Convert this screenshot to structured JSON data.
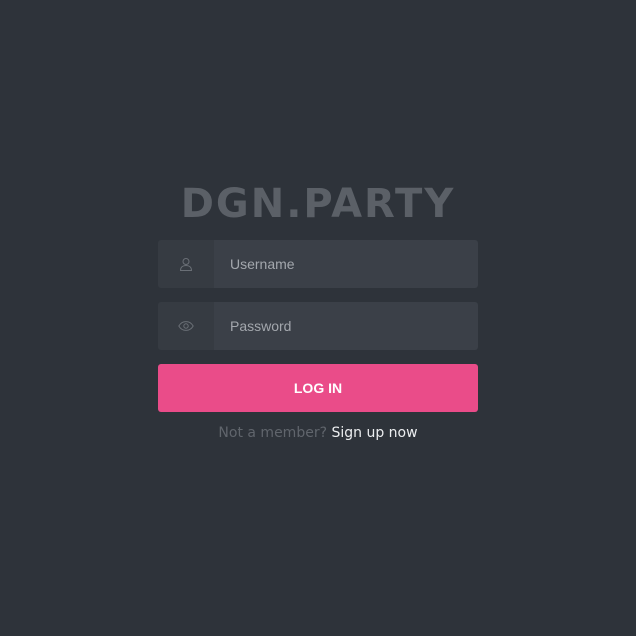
{
  "brand": {
    "title": "DGN.PARTY"
  },
  "login_form": {
    "username": {
      "placeholder": "Username",
      "value": "",
      "icon": "user-icon"
    },
    "password": {
      "placeholder": "Password",
      "value": "",
      "icon": "eye-icon"
    },
    "submit_label": "LOG IN"
  },
  "signup": {
    "prompt": "Not a member?",
    "link_label": "Sign up now"
  },
  "colors": {
    "background": "#2e333a",
    "accent": "#ea4c89",
    "field_bg": "#3b4048",
    "icon_bg": "#363b42",
    "brand_text": "#5b6067"
  }
}
